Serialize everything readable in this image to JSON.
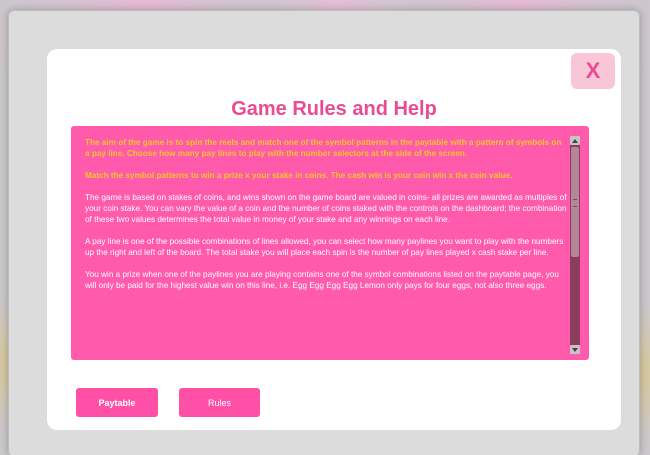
{
  "dialog": {
    "title": "Game Rules and Help",
    "close_label": "X"
  },
  "rules": {
    "highlight_paragraphs": [
      "The aim of the game is to spin the reels and match one of the symbol patterns in the paytable with a pattern of symbols on a pay line. Choose how many pay lines to play with the number selectors at the side of the screen.",
      "Match the symbol patterns to win a prize x your stake in coins. The cash win is your coin win x the coin value."
    ],
    "paragraphs": [
      "The game is based on stakes of coins, and wins shown on the game board are valued in coins- all prizes are awarded as multiples of your coin stake. You can vary the value of a coin and the number of coins staked with the controls on the dashboard; the combination of these two values determines the total value in money of your stake and any winnings on each line.",
      "A pay line is one of the possible combinations of lines allowed, you can select how many paylines you want to play with the numbers up the right and left of the board. The total stake you will place each spin is the number of pay lines played x cash stake per line.",
      "You win a prize when one of the paylines you are playing contains one of the symbol combinations listed on the paytable page, you will only be paid for the highest value win on this line, i.e. Egg Egg Egg Egg Lemon only pays for four eggs, not also three eggs."
    ]
  },
  "tabs": {
    "paytable_label": "Paytable",
    "rules_label": "Rules"
  },
  "colors": {
    "accent": "#ea4b93",
    "panel": "#ff5aac",
    "highlight_text": "#f6c62a",
    "close_bg": "#f9c6d8"
  },
  "icons": {
    "scroll_up": "scroll-up-arrow-icon",
    "scroll_down": "scroll-down-arrow-icon"
  }
}
